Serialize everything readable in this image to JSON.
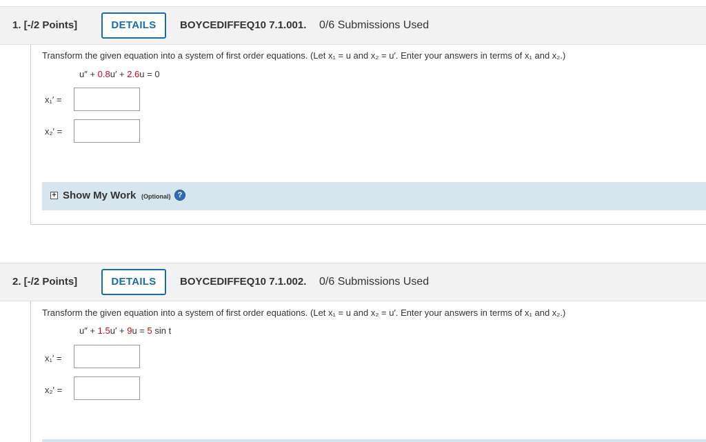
{
  "questions": [
    {
      "number": "1. [-/2 Points]",
      "details_label": "DETAILS",
      "code": "BOYCEDIFFEQ10 7.1.001.",
      "submissions": "0/6 Submissions Used",
      "prompt": "Transform the given equation into a system of first order equations. (Let x₁ = u and x₂ = u′. Enter your answers in terms of x₁ and x₂.)",
      "equation": {
        "part1": "u″ + ",
        "coef1": "0.8",
        "part2": "u′ + ",
        "coef2": "2.6",
        "part3": "u = 0",
        "coef3": "",
        "part4": ""
      },
      "labels": [
        "x₁′  =",
        "x₂′  ="
      ],
      "show_my_work": {
        "label": "Show My Work",
        "optional": "(Optional)",
        "expand": "+",
        "help": "?"
      }
    },
    {
      "number": "2. [-/2 Points]",
      "details_label": "DETAILS",
      "code": "BOYCEDIFFEQ10 7.1.002.",
      "submissions": "0/6 Submissions Used",
      "prompt": "Transform the given equation into a system of first order equations. (Let x₁ = u and x₂ = u′. Enter your answers in terms of x₁ and x₂.)",
      "equation": {
        "part1": "u″ + ",
        "coef1": "1.5",
        "part2": "u′ + ",
        "coef2": "9",
        "part3": "u = ",
        "coef3": "5",
        "part4": " sin t"
      },
      "labels": [
        "x₁′  =",
        "x₂′  ="
      ]
    }
  ]
}
